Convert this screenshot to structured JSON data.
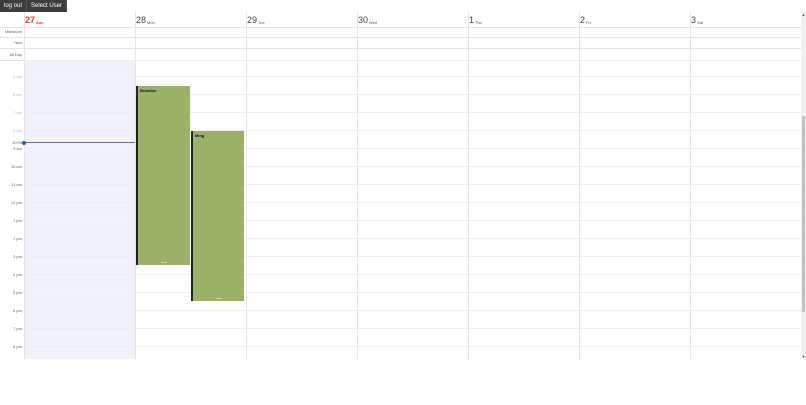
{
  "toolbar": {
    "logout_label": "log out",
    "select_user_label": "Select User"
  },
  "week": [
    {
      "num": "27",
      "name": "Sun",
      "today": true
    },
    {
      "num": "28",
      "name": "Mon",
      "today": false
    },
    {
      "num": "29",
      "name": "Tue",
      "today": false
    },
    {
      "num": "30",
      "name": "Wed",
      "today": false
    },
    {
      "num": "1",
      "name": "Thu",
      "today": false
    },
    {
      "num": "2",
      "name": "Fri",
      "today": false
    },
    {
      "num": "3",
      "name": "Sat",
      "today": false
    }
  ],
  "rows": {
    "milestone": "Milestone",
    "task": "Task",
    "allday": "All Day"
  },
  "time_labels": [
    "5 am",
    "6 am",
    "7 am",
    "8 am",
    "9 am",
    "10 am",
    "11 am",
    "12 pm",
    "1 pm",
    "2 pm",
    "3 pm",
    "4 pm",
    "5 pm",
    "6 pm",
    "7 pm",
    "8 pm"
  ],
  "now_label": "10:00",
  "events": [
    {
      "title": "Brandon",
      "color": "#9db068",
      "day": "Mon"
    },
    {
      "title": "Ming",
      "color": "#9db068",
      "day": "Mon"
    }
  ],
  "colors": {
    "today": "#e53935",
    "now_line": "#3f51b5",
    "today_shade": "#f1f2fd"
  }
}
